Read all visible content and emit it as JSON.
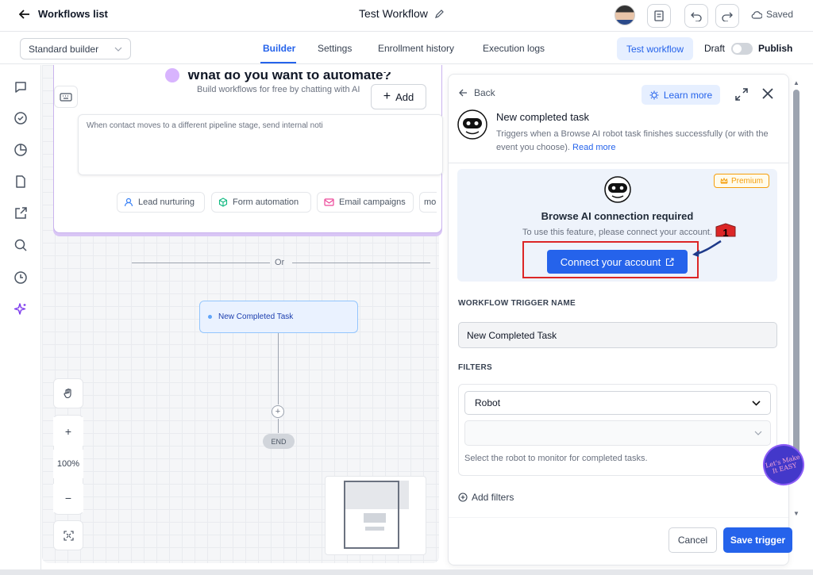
{
  "header": {
    "back_label": "Workflows list",
    "workflow_title": "Test Workflow",
    "saved_label": "Saved"
  },
  "subbar": {
    "builder_mode": "Standard builder",
    "tabs": [
      {
        "label": "Builder",
        "active": true
      },
      {
        "label": "Settings",
        "active": false
      },
      {
        "label": "Enrollment history",
        "active": false
      },
      {
        "label": "Execution logs",
        "active": false
      }
    ],
    "test_workflow_label": "Test workflow",
    "draft_label": "Draft",
    "publish_label": "Publish"
  },
  "left_rail": {
    "icons": [
      "chat-icon",
      "check-circle-icon",
      "pie-chart-icon",
      "file-icon",
      "external-link-icon",
      "search-icon",
      "history-icon",
      "sparkle-icon"
    ]
  },
  "ai_card": {
    "heading": "What do you want to automate?",
    "subheading": "Build workflows for free by chatting with AI",
    "add_label": "Add",
    "prompt_text": "When contact moves to a different pipeline stage, send internal noti",
    "chips": [
      {
        "label": "Lead nurturing",
        "icon": "person-icon"
      },
      {
        "label": "Form automation",
        "icon": "cube-icon"
      },
      {
        "label": "Email campaigns",
        "icon": "mail-icon"
      },
      {
        "label": "mo",
        "icon": ""
      }
    ]
  },
  "canvas": {
    "or_label": "Or",
    "node_label": "New Completed Task",
    "end_label": "END",
    "zoom_level": "100%"
  },
  "panel": {
    "back_label": "Back",
    "learn_more_label": "Learn more",
    "trigger_title": "New completed task",
    "trigger_description": "Triggers when a Browse AI robot task finishes successfully (or with the event you choose).",
    "read_more_label": "Read more",
    "premium_label": "Premium",
    "connection_title": "Browse AI connection required",
    "connection_subtitle": "To use this feature, please connect your account.",
    "connect_button": "Connect your account",
    "trigger_name_label": "WORKFLOW TRIGGER NAME",
    "trigger_name_value": "New Completed Task",
    "filters_label": "FILTERS",
    "filter_field": "Robot",
    "filter_value": "",
    "filter_help": "Select the robot to monitor for completed tasks.",
    "add_filters_label": "Add filters",
    "cancel_label": "Cancel",
    "save_label": "Save trigger",
    "annotation_number": "1"
  },
  "watermark": {
    "text": "Let's Make It EASY"
  },
  "colors": {
    "accent": "#2563eb",
    "premium": "#f59e0b",
    "highlight": "#dc2626"
  }
}
